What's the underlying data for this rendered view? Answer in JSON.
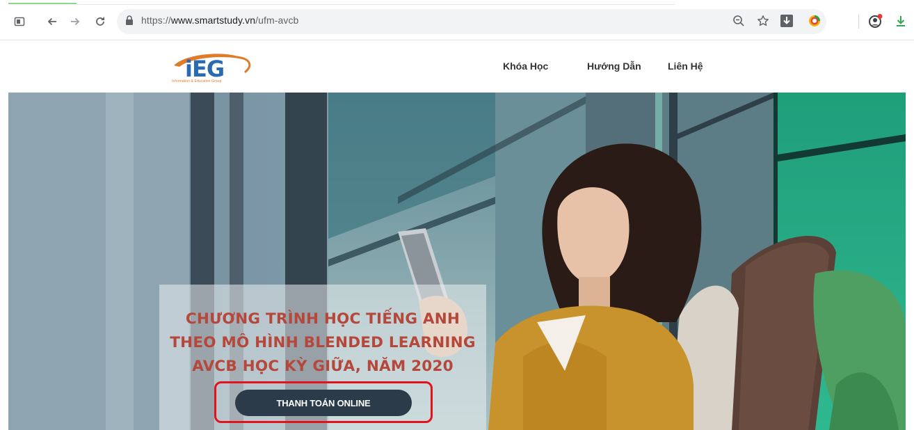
{
  "browser": {
    "url_prefix": "https://",
    "url_host": "www.smartstudy.vn",
    "url_path": "/ufm-avcb",
    "icons": {
      "tab": "tab-switcher-icon",
      "back": "arrow-left-icon",
      "forward": "arrow-right-icon",
      "reload": "reload-icon",
      "lock": "lock-icon",
      "zoom": "zoom-out-icon",
      "bookmark": "star-icon",
      "download": "download-extension-icon",
      "extension": "colorful-extension-icon",
      "profile": "profile-icon",
      "downloads": "downloads-icon"
    }
  },
  "site": {
    "logo_text": "iEG",
    "logo_subtitle": "Information & Education Group",
    "nav": [
      "Khóa Học",
      "Hướng Dẫn",
      "Liên Hệ"
    ]
  },
  "hero": {
    "headline_lines": [
      "CHƯƠNG TRÌNH HỌC TIẾNG ANH",
      "THEO MÔ HÌNH BLENDED LEARNING",
      "AVCB HỌC KỲ GIỮA, NĂM 2020"
    ],
    "cta_label": "THANH TOÁN ONLINE"
  },
  "colors": {
    "headline": "#b5473b",
    "cta_bg": "#2b3b4a",
    "highlight": "#e4121b",
    "logo_blue": "#2a6ab1",
    "logo_orange": "#e07b2a"
  }
}
